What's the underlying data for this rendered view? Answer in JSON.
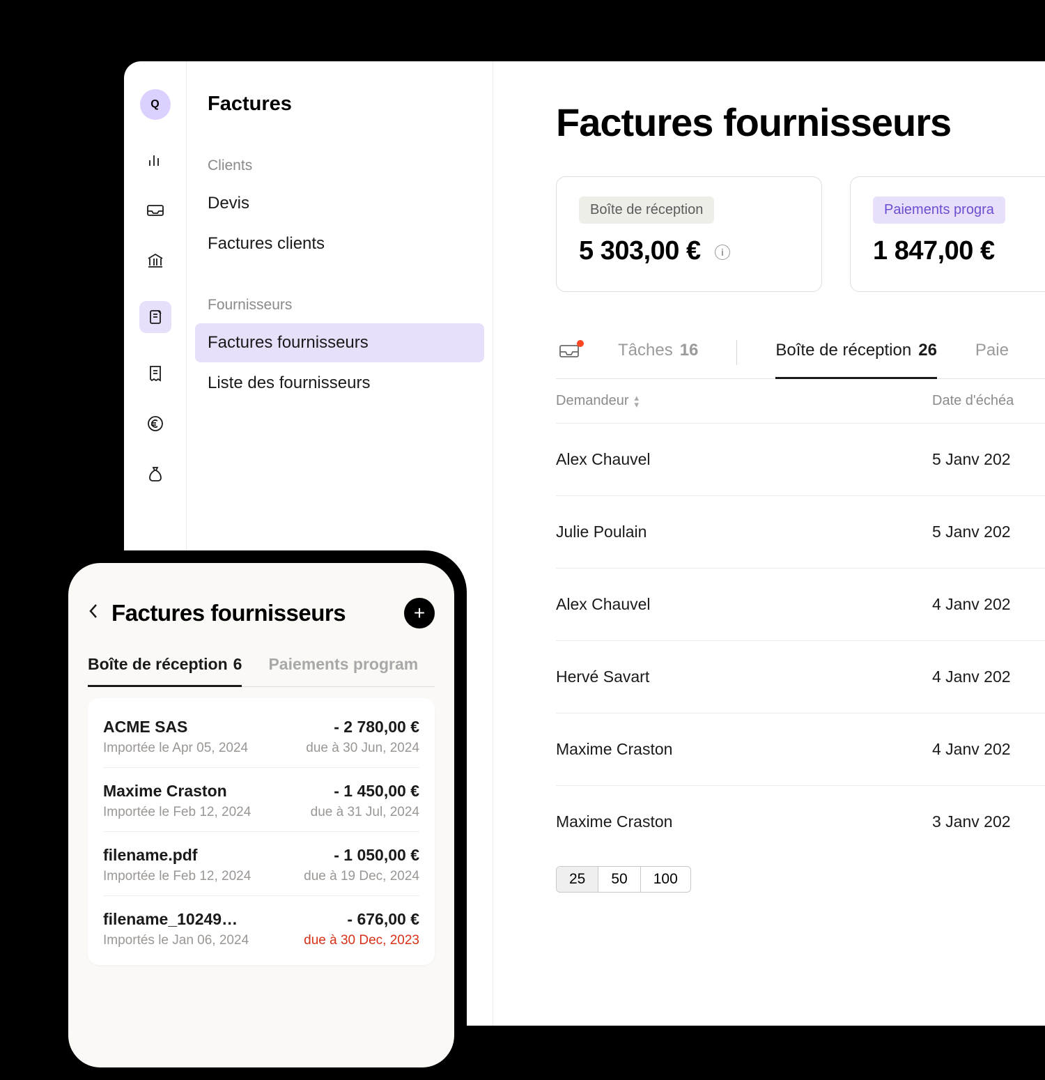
{
  "rail": {
    "logo_letter": "Q"
  },
  "sidebar": {
    "heading": "Factures",
    "group_clients_label": "Clients",
    "item_devis": "Devis",
    "item_factures_clients": "Factures clients",
    "group_fournisseurs_label": "Fournisseurs",
    "item_factures_fournisseurs": "Factures fournisseurs",
    "item_liste_fournisseurs": "Liste des fournisseurs"
  },
  "main": {
    "title": "Factures fournisseurs",
    "card_inbox_label": "Boîte de réception",
    "card_inbox_amount": "5 303,00 €",
    "card_scheduled_label": "Paiements progra",
    "card_scheduled_amount": "1 847,00 €",
    "tab_tasks_label": "Tâches",
    "tab_tasks_count": "16",
    "tab_inbox_label": "Boîte de réception",
    "tab_inbox_count": "26",
    "tab_payments_label": "Paie",
    "col_requester": "Demandeur",
    "col_due": "Date d'échéa",
    "rows": [
      {
        "name": "Alex Chauvel",
        "date": "5 Janv 202"
      },
      {
        "name": "Julie Poulain",
        "date": "5 Janv 202"
      },
      {
        "name": "Alex Chauvel",
        "date": "4 Janv 202"
      },
      {
        "name": "Hervé Savart",
        "date": "4 Janv 202"
      },
      {
        "name": "Maxime Craston",
        "date": "4 Janv 202"
      },
      {
        "name": "Maxime Craston",
        "date": "3 Janv 202"
      }
    ],
    "pager": [
      "25",
      "50",
      "100"
    ]
  },
  "phone": {
    "title": "Factures fournisseurs",
    "tab_inbox_label": "Boîte de réception",
    "tab_inbox_count": "6",
    "tab_scheduled_label": "Paiements program",
    "rows": [
      {
        "name": "ACME SAS",
        "amount": "- 2 780,00 €",
        "imported": "Importée le Apr 05, 2024",
        "due": "due à 30 Jun, 2024",
        "overdue": false
      },
      {
        "name": "Maxime Craston",
        "amount": "- 1 450,00 €",
        "imported": "Importée le Feb 12, 2024",
        "due": "due à 31 Jul, 2024",
        "overdue": false
      },
      {
        "name": "filename.pdf",
        "amount": "- 1 050,00 €",
        "imported": "Importée le Feb 12, 2024",
        "due": "due à 19 Dec, 2024",
        "overdue": false
      },
      {
        "name": "filename_10249…",
        "amount": "- 676,00 €",
        "imported": "Importés le Jan 06, 2024",
        "due": "due à 30 Dec, 2023",
        "overdue": true
      }
    ]
  }
}
